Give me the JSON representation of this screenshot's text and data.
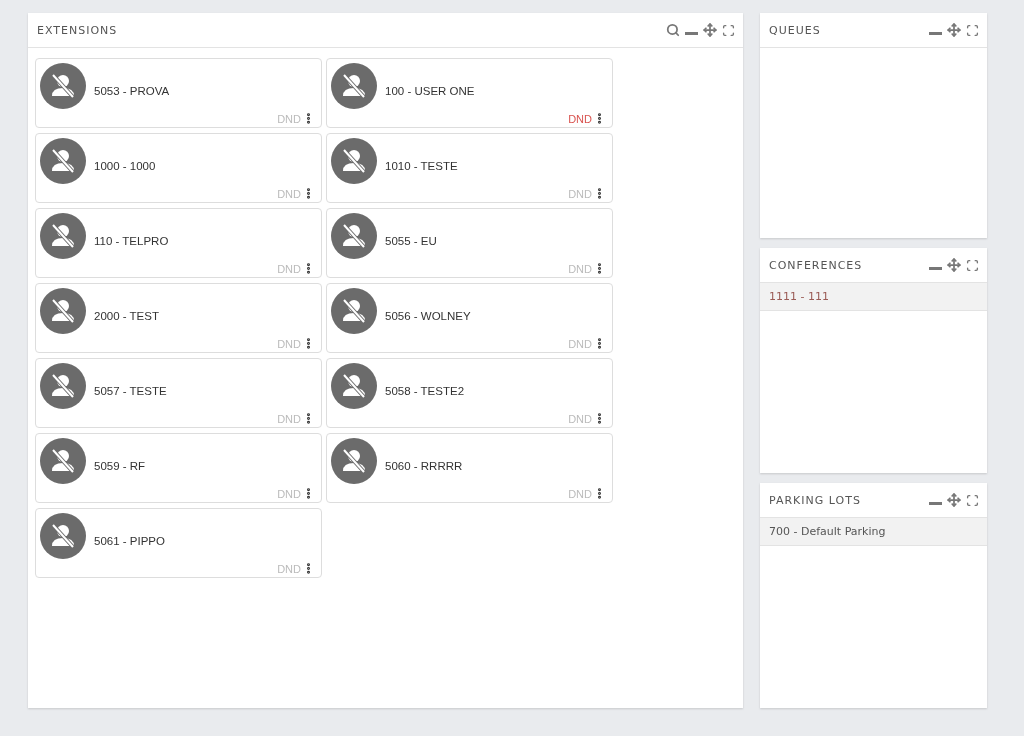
{
  "extensions_panel": {
    "title": "EXTENSIONS",
    "searchable": true,
    "extensions": [
      {
        "label": "5053 - PROVA",
        "dnd_label": "DND",
        "dnd": false
      },
      {
        "label": "100 - USER ONE",
        "dnd_label": "DND",
        "dnd": true
      },
      {
        "label": "1000 - 1000",
        "dnd_label": "DND",
        "dnd": false
      },
      {
        "label": "1010 - TESTE",
        "dnd_label": "DND",
        "dnd": false
      },
      {
        "label": "110 - TELPRO",
        "dnd_label": "DND",
        "dnd": false
      },
      {
        "label": "5055 - EU",
        "dnd_label": "DND",
        "dnd": false
      },
      {
        "label": "2000 - TEST",
        "dnd_label": "DND",
        "dnd": false
      },
      {
        "label": "5056 - WOLNEY",
        "dnd_label": "DND",
        "dnd": false
      },
      {
        "label": "5057 - TESTE",
        "dnd_label": "DND",
        "dnd": false
      },
      {
        "label": "5058 - TESTE2",
        "dnd_label": "DND",
        "dnd": false
      },
      {
        "label": "5059 - RF",
        "dnd_label": "DND",
        "dnd": false
      },
      {
        "label": "5060 - RRRRR",
        "dnd_label": "DND",
        "dnd": false
      },
      {
        "label": "5061 - PIPPO",
        "dnd_label": "DND",
        "dnd": false
      }
    ]
  },
  "side_panels": [
    {
      "title": "QUEUES",
      "searchable": false
    },
    {
      "title": "CONFERENCES",
      "searchable": false,
      "items": [
        {
          "label": "1111 - 111",
          "kind": "conference"
        }
      ]
    },
    {
      "title": "PARKING LOTS",
      "searchable": false,
      "items": [
        {
          "label": "700 - Default Parking",
          "kind": "parking"
        }
      ]
    }
  ]
}
